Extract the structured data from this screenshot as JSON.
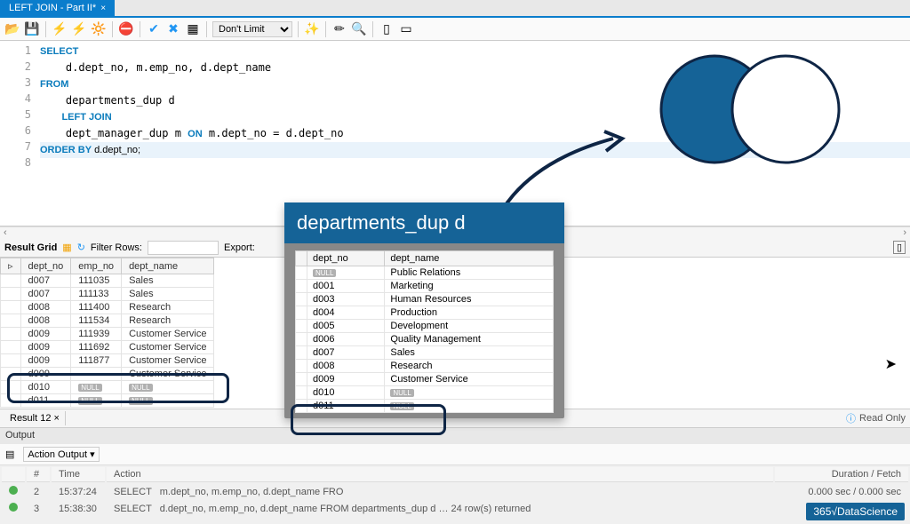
{
  "tab": {
    "title": "LEFT JOIN - Part II*"
  },
  "toolbar": {
    "limit": "Don't Limit"
  },
  "code": [
    {
      "n": 1,
      "t": "SELECT",
      "kw": true
    },
    {
      "n": 2,
      "t": "    d.dept_no, m.emp_no, d.dept_name"
    },
    {
      "n": 3,
      "t": "FROM",
      "kw": true
    },
    {
      "n": 4,
      "t": "    departments_dup d"
    },
    {
      "n": 5,
      "t": "        LEFT JOIN",
      "kw": true
    },
    {
      "n": 6,
      "t": "    dept_manager_dup m ON m.dept_no = d.dept_no",
      "on": true
    },
    {
      "n": 7,
      "t": "ORDER BY d.dept_no;",
      "ob": true,
      "hl": true
    },
    {
      "n": 8,
      "t": ""
    }
  ],
  "result_bar": {
    "grid": "Result Grid",
    "filter": "Filter Rows:",
    "export": "Export:"
  },
  "grid": {
    "cols": [
      "dept_no",
      "emp_no",
      "dept_name"
    ],
    "rows": [
      [
        "d007",
        "111035",
        "Sales"
      ],
      [
        "d007",
        "111133",
        "Sales"
      ],
      [
        "d008",
        "111400",
        "Research"
      ],
      [
        "d008",
        "111534",
        "Research"
      ],
      [
        "d009",
        "111939",
        "Customer Service"
      ],
      [
        "d009",
        "111692",
        "Customer Service"
      ],
      [
        "d009",
        "111877",
        "Customer Service"
      ],
      [
        "d009",
        "",
        "Customer Service"
      ],
      [
        "d010",
        "NULL",
        "NULL"
      ],
      [
        "d011",
        "NULL",
        "NULL"
      ]
    ]
  },
  "panel": {
    "result_tab": "Result 12",
    "read_only": "Read Only"
  },
  "output": {
    "header": "Output",
    "mode": "Action Output",
    "cols": {
      "hash": "#",
      "time": "Time",
      "action": "Action",
      "duration": "Duration / Fetch"
    },
    "rows": [
      {
        "n": "2",
        "time": "15:37:24",
        "verb": "SELECT",
        "rest": "m.dept_no, m.emp_no, d.dept_name FRO",
        "dur": "0.000 sec / 0.000 sec"
      },
      {
        "n": "3",
        "time": "15:38:30",
        "verb": "SELECT",
        "rest": "d.dept_no, m.emp_no, d.dept_name FROM    departments_dup d …    24 row(s) returned",
        "dur": "0.000 sec / 0.000 sec"
      }
    ]
  },
  "overlay": {
    "title": "departments_dup d",
    "cols": [
      "dept_no",
      "dept_name"
    ],
    "rows": [
      [
        "NULL",
        "Public Relations"
      ],
      [
        "d001",
        "Marketing"
      ],
      [
        "d003",
        "Human Resources"
      ],
      [
        "d004",
        "Production"
      ],
      [
        "d005",
        "Development"
      ],
      [
        "d006",
        "Quality Management"
      ],
      [
        "d007",
        "Sales"
      ],
      [
        "d008",
        "Research"
      ],
      [
        "d009",
        "Customer Service"
      ],
      [
        "d010",
        "NULL"
      ],
      [
        "d011",
        "NULL"
      ]
    ]
  },
  "watermark": "365√DataScience"
}
